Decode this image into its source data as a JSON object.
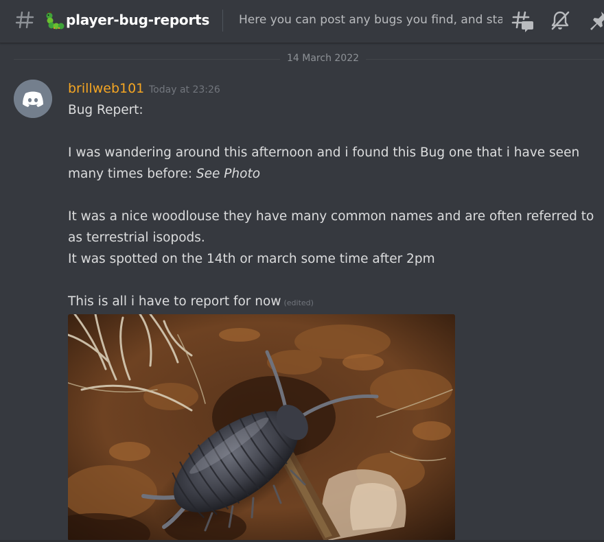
{
  "header": {
    "hash_icon": "hash-icon",
    "channel_emoji": "caterpillar-emoji",
    "channel_name": "player-bug-reports",
    "topic": "Here you can post any bugs you find, and sta...",
    "icons": [
      "threads-icon",
      "mute-icon",
      "pin-icon"
    ]
  },
  "date_divider": {
    "label": "14 March 2022"
  },
  "message": {
    "avatar_icon": "discord-logo-icon",
    "author": "brillweb101",
    "timestamp": "Today at 23:26",
    "lines": [
      "Bug Repert:",
      "I was wandering around this afternoon and i found this Bug one that i have seen",
      "many times before: ",
      "See Photo",
      "It was a nice woodlouse they have many common names and are often referred to",
      "as terrestrial isopods.",
      "It was spotted on the 14th or march some time after 2pm",
      "This is all i have to report for now"
    ],
    "edited_label": "(edited)",
    "attachment": "woodlouse-photo"
  },
  "colors": {
    "background": "#36393f",
    "author_color": "#f5a623",
    "text": "#dcddde",
    "muted": "#72767d",
    "avatar_bg": "#747f8d"
  }
}
